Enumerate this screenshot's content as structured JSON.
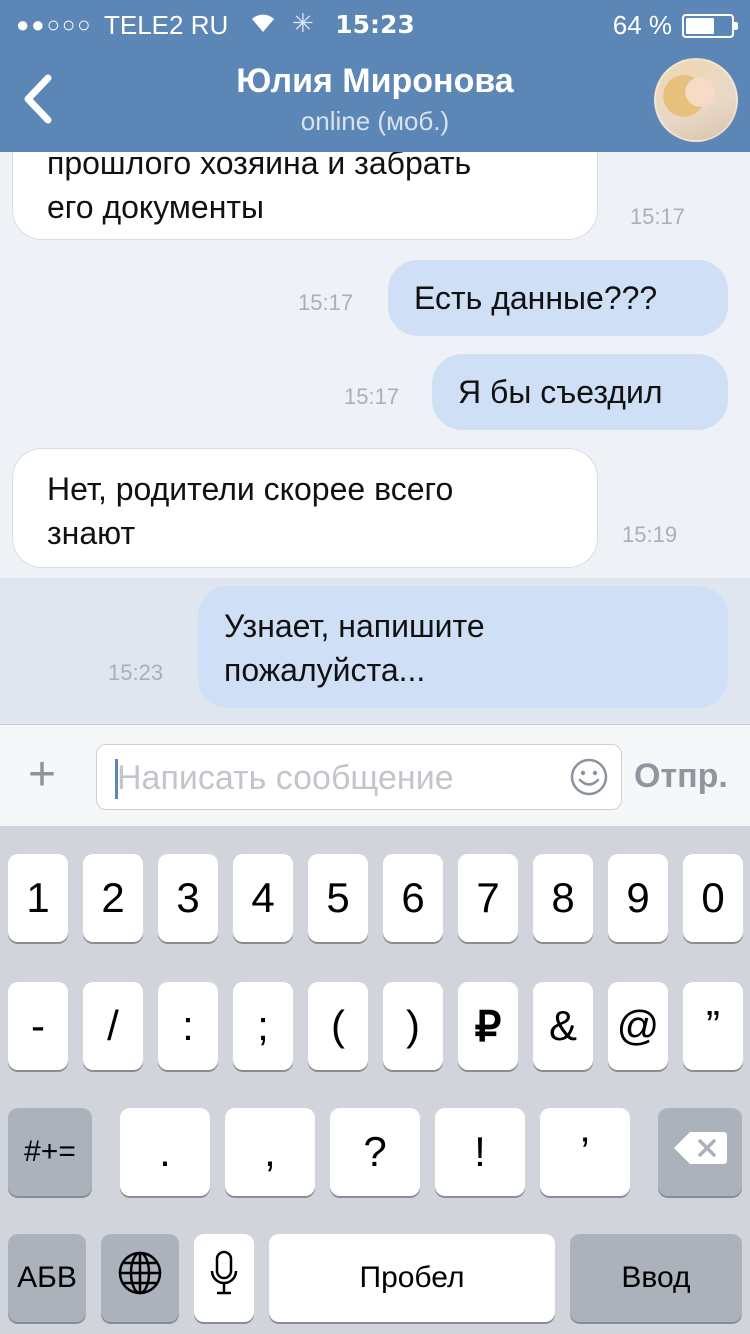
{
  "status_bar": {
    "signal": "●●○○○",
    "carrier": "TELE2 RU",
    "time": "15:23",
    "battery_percent": "64 %",
    "battery_level": 0.64
  },
  "header": {
    "contact_name": "Юлия Миронова",
    "contact_status": "online (моб.)"
  },
  "messages": [
    {
      "dir": "in",
      "line1": "прошлого хозяина и забрать",
      "line2": "его документы",
      "time": "15:17"
    },
    {
      "dir": "out",
      "text": "Есть данные???",
      "time": "15:17"
    },
    {
      "dir": "out",
      "text": "Я бы съездил",
      "time": "15:17"
    },
    {
      "dir": "in",
      "line1": "Нет, родители скорее всего",
      "line2": "знают",
      "time": "15:19"
    },
    {
      "dir": "out",
      "line1": "Узнает, напишите",
      "line2": "пожалуйста...",
      "time": "15:23"
    }
  ],
  "composer": {
    "plus": "+",
    "placeholder": "Написать сообщение",
    "send_label": "Отпр."
  },
  "keyboard": {
    "row1": [
      "1",
      "2",
      "3",
      "4",
      "5",
      "6",
      "7",
      "8",
      "9",
      "0"
    ],
    "row2": [
      "-",
      "/",
      ":",
      ";",
      "(",
      ")",
      "₽",
      "&",
      "@",
      "”"
    ],
    "row3_mode": "#+=",
    "row3": [
      ".",
      ",",
      "?",
      "!",
      "’"
    ],
    "row4_abc": "АБВ",
    "space": "Пробел",
    "enter": "Ввод"
  },
  "colors": {
    "header": "#5c86b6",
    "outgoing_bubble": "#cfe0f6",
    "incoming_bubble": "#ffffff"
  }
}
